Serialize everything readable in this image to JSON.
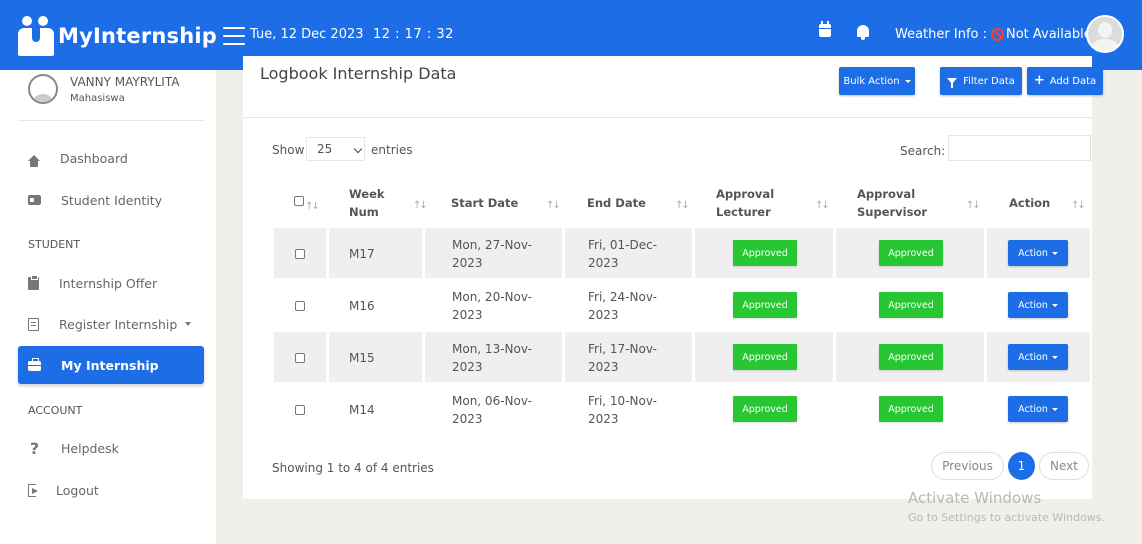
{
  "header": {
    "brand": "MyInternship",
    "date": "Tue, 12 Dec 2023",
    "time": "12 : 17 : 32",
    "weather_label": "Weather Info :",
    "weather_value": "Not Available",
    "icons": [
      "calendar-icon",
      "bell-icon",
      "no-entry-icon",
      "avatar"
    ],
    "accent_color": "#1d6ee6"
  },
  "sidebar": {
    "user_name": "VANNY MAYRYLITA",
    "user_role": "Mahasiswa",
    "items": [
      {
        "label": "Dashboard",
        "icon": "home-icon"
      },
      {
        "label": "Student Identity",
        "icon": "id-card-icon"
      }
    ],
    "section_student": "STUDENT",
    "student_items": [
      {
        "label": "Internship Offer",
        "icon": "clipboard-icon"
      },
      {
        "label": "Register Internship",
        "icon": "form-icon"
      },
      {
        "label": "My Internship",
        "icon": "briefcase-icon",
        "active": true
      }
    ],
    "section_account": "ACCOUNT",
    "account_items": [
      {
        "label": "Helpdesk",
        "icon": "question-icon"
      },
      {
        "label": "Logout",
        "icon": "logout-icon"
      }
    ]
  },
  "main": {
    "title": "Logbook Internship Data",
    "bulk_action": "Bulk Action",
    "filter_data": "Filter Data",
    "add_data": "Add Data",
    "show_label": "Show",
    "entries_value": "25",
    "entries_label": "entries",
    "search_label": "Search:",
    "search_value": "",
    "columns": {
      "week_1": "Week",
      "week_2": "Num",
      "start": "Start Date",
      "end": "End Date",
      "lect_1": "Approval",
      "lect_2": "Lecturer",
      "sup_1": "Approval",
      "sup_2": "Supervisor",
      "action": "Action"
    },
    "rows": [
      {
        "week": "M17",
        "start_1": "Mon, 27-Nov-",
        "start_2": "2023",
        "end_1": "Fri, 01-Dec-",
        "end_2": "2023",
        "lecturer": "Approved",
        "supervisor": "Approved",
        "action": "Action"
      },
      {
        "week": "M16",
        "start_1": "Mon, 20-Nov-",
        "start_2": "2023",
        "end_1": "Fri, 24-Nov-",
        "end_2": "2023",
        "lecturer": "Approved",
        "supervisor": "Approved",
        "action": "Action"
      },
      {
        "week": "M15",
        "start_1": "Mon, 13-Nov-",
        "start_2": "2023",
        "end_1": "Fri, 17-Nov-",
        "end_2": "2023",
        "lecturer": "Approved",
        "supervisor": "Approved",
        "action": "Action"
      },
      {
        "week": "M14",
        "start_1": "Mon, 06-Nov-",
        "start_2": "2023",
        "end_1": "Fri, 10-Nov-",
        "end_2": "2023",
        "lecturer": "Approved",
        "supervisor": "Approved",
        "action": "Action"
      }
    ],
    "showing": "Showing 1 to 4 of 4 entries",
    "pagination": {
      "previous": "Previous",
      "page": "1",
      "next": "Next"
    }
  },
  "watermark": {
    "line1": "Activate Windows",
    "line2": "Go to Settings to activate Windows."
  }
}
